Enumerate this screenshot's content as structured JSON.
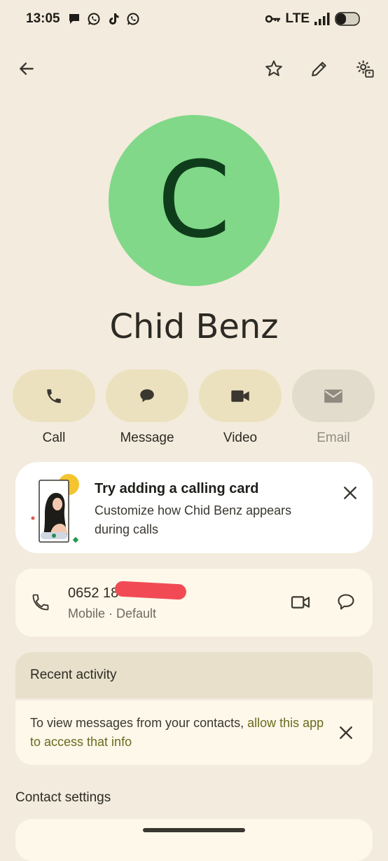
{
  "status": {
    "time": "13:05",
    "network": "LTE",
    "left_icons": [
      "chat-bubble-icon",
      "whatsapp-icon",
      "tiktok-icon",
      "whatsapp-icon"
    ],
    "right_icons": [
      "vpn-key-icon",
      "signal-icon",
      "battery-icon"
    ]
  },
  "toolbar": {
    "back_icon": "arrow-back-icon",
    "favorite_icon": "star-outline-icon",
    "edit_icon": "pencil-icon",
    "settings_icon": "manage-contact-icon"
  },
  "contact": {
    "initial": "C",
    "name": "Chid Benz",
    "avatar_color": "#80d888"
  },
  "actions": [
    {
      "label": "Call",
      "icon": "phone-icon",
      "enabled": true
    },
    {
      "label": "Message",
      "icon": "message-bubble-icon",
      "enabled": true
    },
    {
      "label": "Video",
      "icon": "videocam-icon",
      "enabled": true
    },
    {
      "label": "Email",
      "icon": "mail-icon",
      "enabled": false
    }
  ],
  "promo": {
    "title": "Try adding a calling card",
    "text": "Customize how Chid Benz appears during calls",
    "close_icon": "close-icon"
  },
  "phone": {
    "number": "0652 18",
    "type": "Mobile · Default",
    "redacted": true
  },
  "recent": {
    "title": "Recent activity",
    "text_prefix": "To view messages from your contacts, ",
    "link": "allow this app to access that info"
  },
  "contact_settings": {
    "title": "Contact settings"
  },
  "colors": {
    "background": "#f3ebdd",
    "action_pill": "#ece1be",
    "accent_link": "#6b6a1f"
  }
}
